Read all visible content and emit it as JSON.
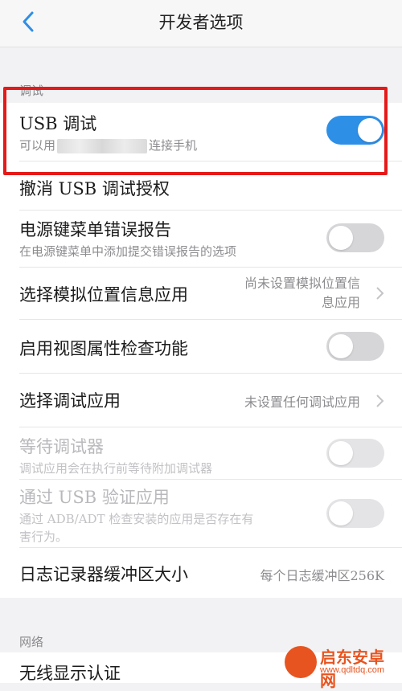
{
  "header": {
    "title": "开发者选项"
  },
  "sections": {
    "debug": "调试",
    "network": "网络"
  },
  "rows": {
    "usb_debug": {
      "title": "USB 调试",
      "sub_prefix": "可以用",
      "sub_suffix": "连接手机",
      "state": "on"
    },
    "revoke": {
      "title": "撤消 USB 调试授权"
    },
    "power_bug": {
      "title": "电源键菜单错误报告",
      "sub": "在电源键菜单中添加提交错误报告的选项",
      "state": "off"
    },
    "mock_location": {
      "title": "选择模拟位置信息应用",
      "value_line1": "尚未设置模拟位置信",
      "value_line2": "息应用"
    },
    "view_attr": {
      "title": "启用视图属性检查功能",
      "state": "off"
    },
    "debug_app": {
      "title": "选择调试应用",
      "value": "未设置任何调试应用"
    },
    "wait_debugger": {
      "title": "等待调试器",
      "sub": "调试应用会在执行前等待附加调试器",
      "state": "disabled"
    },
    "verify_usb": {
      "title": "通过 USB 验证应用",
      "sub": "通过 ADB/ADT 检查安装的应用是否存在有",
      "sub2": "害行为。",
      "state": "disabled"
    },
    "log_buffer": {
      "title": "日志记录器缓冲区大小",
      "value": "每个日志缓冲区256K"
    },
    "wireless_display": {
      "title": "无线显示认证"
    }
  },
  "watermark": {
    "name": "启东安卓网",
    "url": "www.qdltdq.com"
  },
  "colors": {
    "accent": "#2e8fe6",
    "highlight": "#e61919"
  }
}
